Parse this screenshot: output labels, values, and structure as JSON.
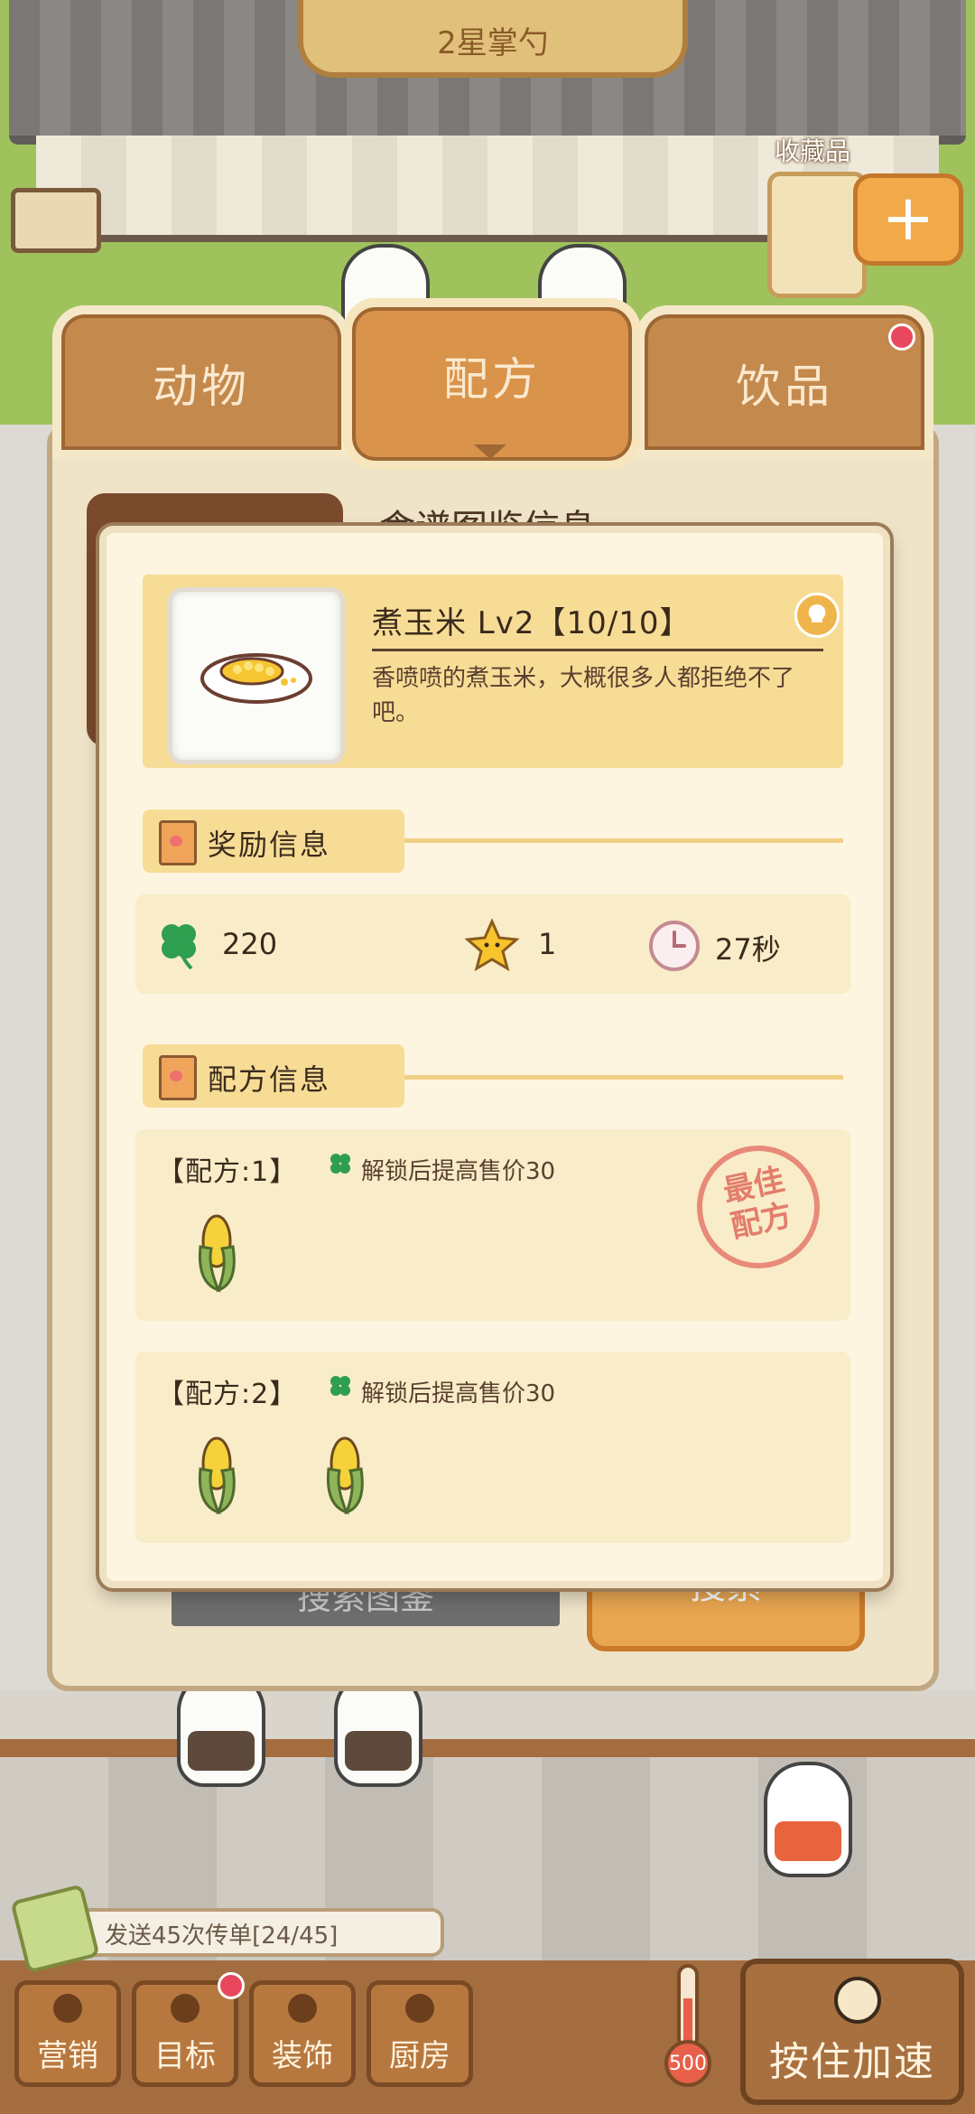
{
  "scene": {
    "rank_label": "2星掌勺",
    "collection_label": "收藏品"
  },
  "tabs": [
    {
      "label": "动物",
      "active": false
    },
    {
      "label": "配方",
      "active": true
    },
    {
      "label": "饮品",
      "active": false,
      "has_dot": true
    }
  ],
  "back_panel": {
    "title": "食谱图鉴信息",
    "search_placeholder": "搜索图鉴",
    "search_button": "搜索"
  },
  "dish": {
    "icon": "corn-plate-icon",
    "title": "煮玉米 Lv2【10/10】",
    "description": "香喷喷的煮玉米，大概很多人都拒绝不了吧。"
  },
  "reward_section": {
    "label": "奖励信息",
    "clover_value": "220",
    "star_value": "1",
    "time_value": "27秒"
  },
  "recipe_section": {
    "label": "配方信息",
    "recipes": [
      {
        "title": "【配方:1】",
        "note": "解锁后提高售价30",
        "corn_count": 1,
        "best": true
      },
      {
        "title": "【配方:2】",
        "note": "解锁后提高售价30",
        "corn_count": 2,
        "best": false
      }
    ],
    "best_stamp_line1": "最佳",
    "best_stamp_line2": "配方"
  },
  "hud": {
    "task_text": "发送45次传单[24/45]",
    "buttons": [
      {
        "label": "营销",
        "has_dot": false
      },
      {
        "label": "目标",
        "has_dot": true
      },
      {
        "label": "装饰",
        "has_dot": false
      },
      {
        "label": "厨房",
        "has_dot": false
      }
    ],
    "thermo_value": "500",
    "speed_label": "按住加速"
  },
  "colors": {
    "accent_orange": "#d9934a",
    "clover_green": "#2e9e4f",
    "star_yellow": "#f7c42b",
    "stamp_red": "#e06a5c"
  }
}
